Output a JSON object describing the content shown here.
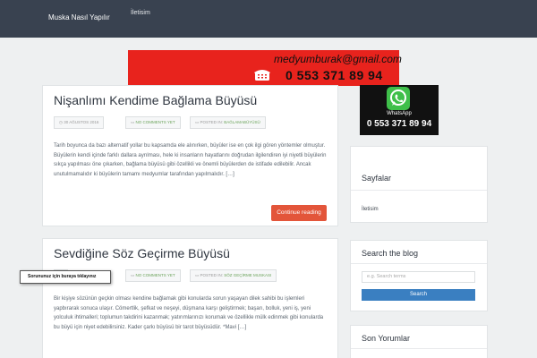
{
  "header": {
    "brand": "Muska Nasıl Yapılır",
    "nav": [
      "İletisim"
    ]
  },
  "banner": {
    "email": "medyumburak@gmail.com",
    "phone": "0 553 371 89 94"
  },
  "posts": [
    {
      "title": "Nişanlımı Kendime Bağlama Büyüsü",
      "date": "30 AĞUSTOS 2016",
      "comments": "NO COMMENTS YET",
      "category_prefix": "POSTED IN:",
      "category": "BAĞLAMABÜYÜSÜ",
      "excerpt": "Tarih boyunca da bazı alternatif yollar bu kapsamda ele alınırken, büyüler ise en çok ilgi gören yöntemler olmuştur. Büyülerin kendi içinde farklı dallara ayrılması, hele ki insanların hayatlarını doğrudan ilgilendiren iyi niyetli büyülerin sıkça yapılması öne çıkarken, bağlama büyüsü gibi özellikli ve önemli büyülerden de istifade edilebilir. Ancak unutulmamalıdır ki büyülerin tamamı medyumlar tarafından yapılmalıdır. […]",
      "button": "Continue reading"
    },
    {
      "title": "Sevdiğine Söz Geçirme Büyüsü",
      "date": "",
      "comments": "NO COMMENTS YET",
      "category_prefix": "POSTED IN:",
      "category": "SÖZ GEÇİRME MUSKASI",
      "excerpt": "Bir kişiye sözünün geçkin olması kendine bağlamak gibi konularda sorun yaşayan dilek sahibi bu işlemleri yapbırarak sonuca ulaşır. Cömertlik, şefkat ve neşeyi, düşmana karşı geliştirmek; başarı, bolluk, yeni iş, yeni yolculuk ihtimalleri; toplumun takdirini kazanmak; yatırımlarınızı korumak ve özellikle mülk edinmek gibi konularda bu büyü için niyet edebilirsiniz. Kader çarkı büyüsü bir tarot büyüsüdür. *Mavi […]"
    }
  ],
  "tooltip": "Sorununuz için buraya tıklayınız",
  "sidebar": {
    "whatsapp_label": "WhatsApp",
    "whatsapp_phone": "0 553 371 89 94",
    "pages_title": "Sayfalar",
    "pages": [
      "İletisim"
    ],
    "search_title": "Search the blog",
    "search_placeholder": "e.g. Search terms",
    "search_button": "Search",
    "comments_title": "Son Yorumlar"
  },
  "colors": {
    "topbar": "#394250",
    "banner": "#e8231d",
    "accent_button": "#e3553a",
    "search_button": "#3a7fc1",
    "category_text": "#6ba35a"
  }
}
